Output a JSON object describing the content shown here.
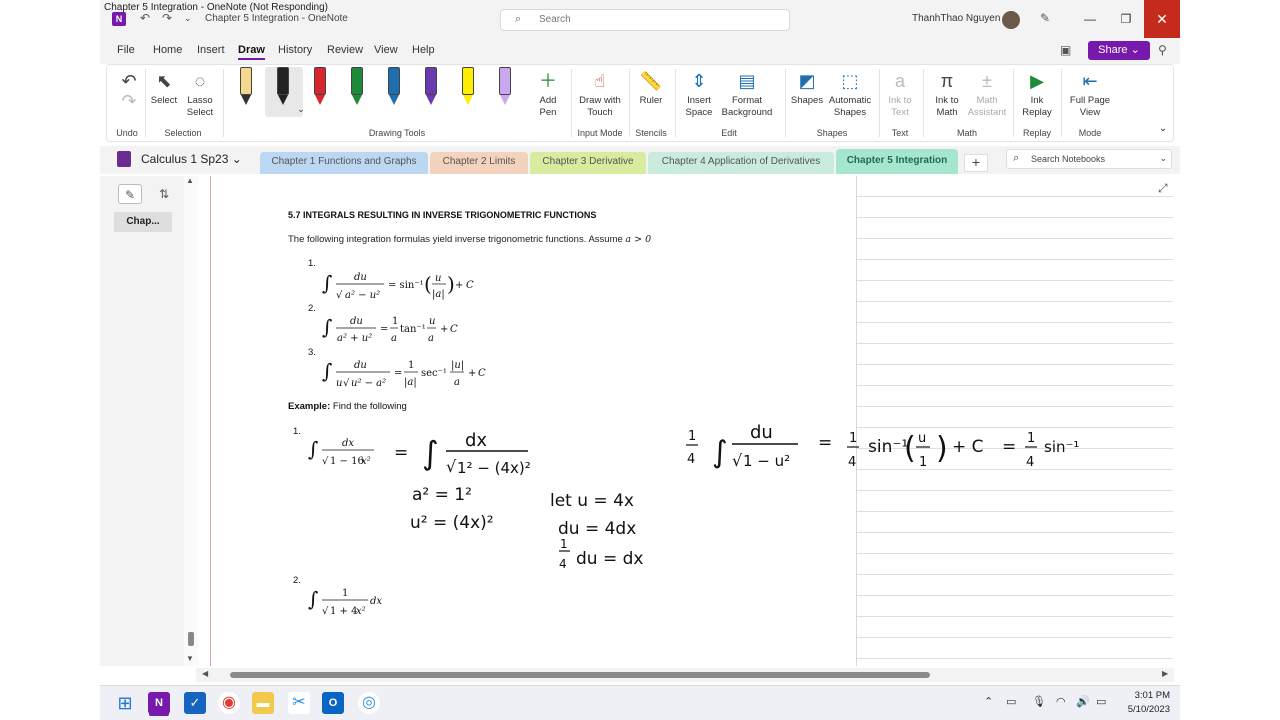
{
  "window": {
    "title_top": "Chapter 5 Integration  - OneNote (Not Responding)",
    "title": "Chapter 5 Integration  -  OneNote",
    "search_placeholder": "Search",
    "user": "ThanhThao Nguyen"
  },
  "menu": {
    "items": [
      "File",
      "Home",
      "Insert",
      "Draw",
      "History",
      "Review",
      "View",
      "Help"
    ],
    "active": "Draw",
    "share_label": "Share"
  },
  "ribbon": {
    "undo": {
      "label": "Undo"
    },
    "select": "Select",
    "lasso": "Lasso\nSelect",
    "add_pen": "Add\nPen",
    "draw_touch": "Draw with\nTouch",
    "ruler": "Ruler",
    "insert_space": "Insert\nSpace",
    "format_bg": "Format\nBackground",
    "shapes": "Shapes",
    "auto_shapes": "Automatic\nShapes",
    "ink_text": "Ink to\nText",
    "ink_math": "Ink to\nMath",
    "math_assistant": "Math\nAssistant",
    "ink_replay": "Ink\nReplay",
    "full_page": "Full Page\nView",
    "groups": {
      "undo": "Undo",
      "selection": "Selection",
      "drawing_tools": "Drawing Tools",
      "input_mode": "Input Mode",
      "stencils": "Stencils",
      "edit": "Edit",
      "shapes": "Shapes",
      "text": "Text",
      "math": "Math",
      "replay": "Replay",
      "mode": "Mode"
    },
    "pen_colors": [
      "#f5d78e",
      "#222222",
      "#d9262e",
      "#1f8a3a",
      "#1e6fb0",
      "#6a3ab0",
      "#ffee00",
      "#c9a8f0"
    ]
  },
  "notebook": {
    "name": "Calculus 1 Sp23",
    "tabs": [
      {
        "label": "Chapter 1 Functions and Graphs",
        "color": "#bcd7f2"
      },
      {
        "label": "Chapter 2 Limits",
        "color": "#f3d3bd"
      },
      {
        "label": "Chapter 3 Derivative",
        "color": "#d7ec9e"
      },
      {
        "label": "Chapter 4 Application of Derivatives",
        "color": "#c9ecdf"
      },
      {
        "label": "Chapter 5 Integration",
        "color": "#a6e6cf"
      }
    ],
    "active_tab": "Chapter 5 Integration",
    "search_placeholder": "Search Notebooks"
  },
  "pages": {
    "items": [
      "Chap..."
    ]
  },
  "content": {
    "heading": "5.7 INTEGRALS RESULTING IN INVERSE TRIGONOMETRIC FUNCTIONS",
    "intro": "The following integration formulas yield inverse trigonometric functions. Assume",
    "intro_math": "a > 0",
    "numbers": [
      "1.",
      "2.",
      "3."
    ],
    "example_label": "Example:",
    "example_text": " Find the following",
    "ex_numbers": [
      "1.",
      "2."
    ]
  },
  "taskbar": {
    "time": "3:01 PM",
    "date": "5/10/2023"
  }
}
